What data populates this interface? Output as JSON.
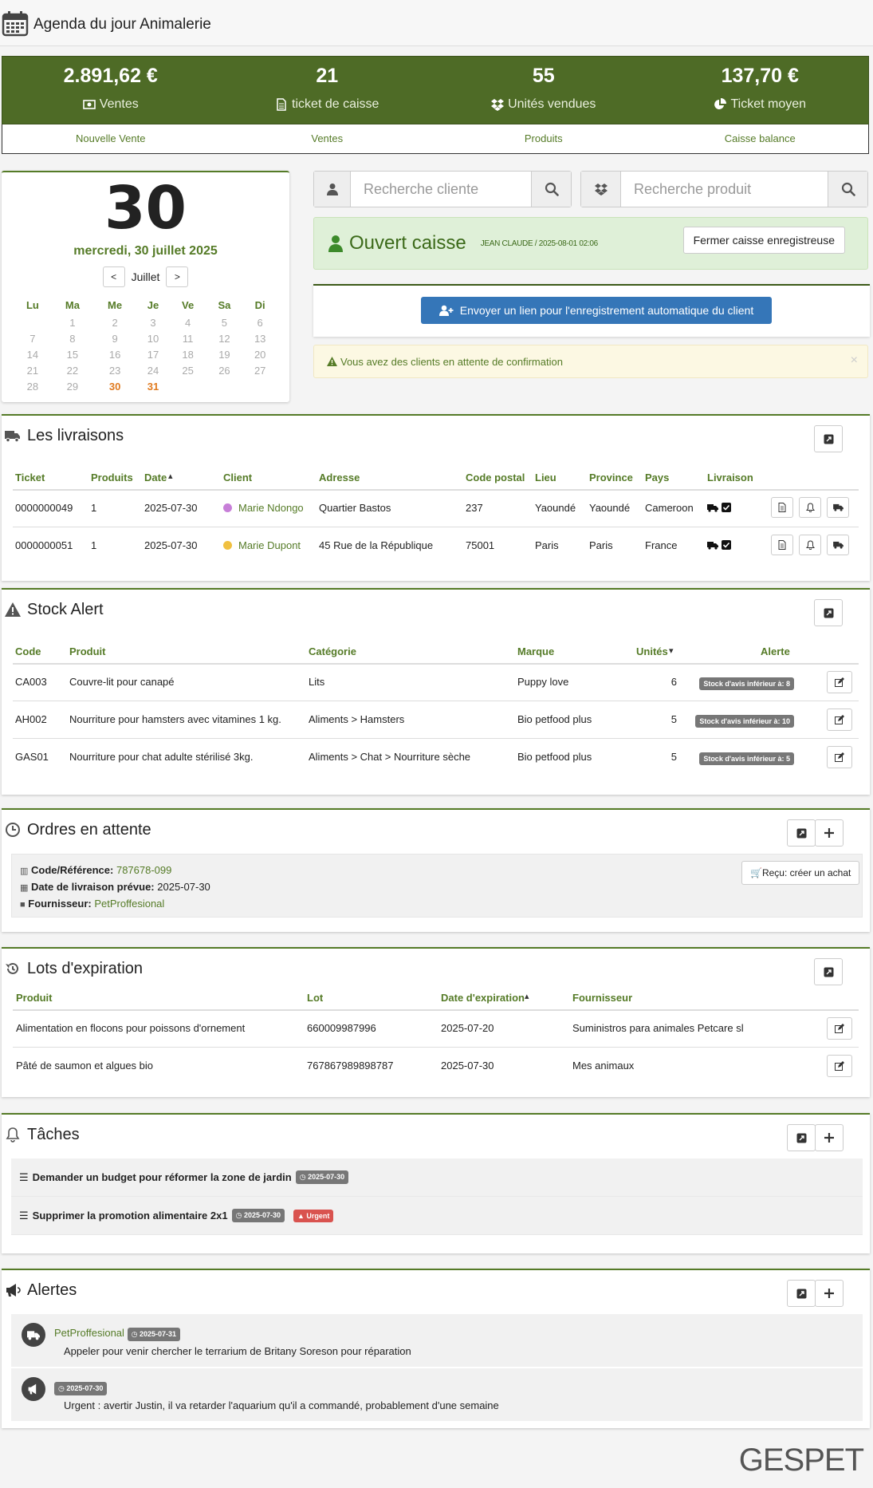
{
  "header": {
    "title": "Agenda du jour Animalerie"
  },
  "stats": [
    {
      "value": "2.891,62 €",
      "label": "Ventes",
      "icon": "money-icon"
    },
    {
      "value": "21",
      "label": "ticket de caisse",
      "icon": "file-icon"
    },
    {
      "value": "55",
      "label": "Unités vendues",
      "icon": "dropbox-icon"
    },
    {
      "value": "137,70 €",
      "label": "Ticket moyen",
      "icon": "pie-chart-icon"
    }
  ],
  "links": [
    "Nouvelle Vente",
    "Ventes",
    "Produits",
    "Caisse balance"
  ],
  "calendar": {
    "day": "30",
    "date": "mercredi, 30 juillet 2025",
    "prev": "<",
    "next": ">",
    "month": "Juillet",
    "weekdays": [
      "Lu",
      "Ma",
      "Me",
      "Je",
      "Ve",
      "Sa",
      "Di"
    ],
    "weeks": [
      [
        "",
        "1",
        "2",
        "3",
        "4",
        "5",
        "6"
      ],
      [
        "7",
        "8",
        "9",
        "10",
        "11",
        "12",
        "13"
      ],
      [
        "14",
        "15",
        "16",
        "17",
        "18",
        "19",
        "20"
      ],
      [
        "21",
        "22",
        "23",
        "24",
        "25",
        "26",
        "27"
      ],
      [
        "28",
        "29",
        "30",
        "31",
        "",
        "",
        ""
      ]
    ],
    "highlight": [
      "30",
      "31"
    ]
  },
  "search": {
    "client_placeholder": "Recherche cliente",
    "product_placeholder": "Recherche produit"
  },
  "register": {
    "status": "Ouvert caisse",
    "info": "JEAN CLAUDE / 2025-08-01 02:06",
    "close_button": "Fermer caisse enregistreuse"
  },
  "send_link": {
    "label": "Envoyer un lien pour l'enregistrement  automatique du client"
  },
  "warning": {
    "text": "Vous avez des clients en attente de confirmation",
    "close": "×"
  },
  "deliveries": {
    "title": "Les livraisons",
    "columns": [
      "Ticket",
      "Produits",
      "Date",
      "Client",
      "Adresse",
      "Code postal",
      "Lieu",
      "Province",
      "Pays",
      "Livraison"
    ],
    "rows": [
      {
        "ticket": "0000000049",
        "products": "1",
        "date": "2025-07-30",
        "client": "Marie Ndongo",
        "client_color": "#c77fd8",
        "address": "Quartier Bastos",
        "postal": "237",
        "city": "Yaoundé",
        "province": "Yaoundé",
        "country": "Cameroon"
      },
      {
        "ticket": "0000000051",
        "products": "1",
        "date": "2025-07-30",
        "client": "Marie Dupont",
        "client_color": "#f0c040",
        "address": "45 Rue de la République",
        "postal": "75001",
        "city": "Paris",
        "province": "Paris",
        "country": "France"
      }
    ]
  },
  "stock": {
    "title": "Stock Alert",
    "columns": [
      "Code",
      "Produit",
      "Catégorie",
      "Marque",
      "Unités",
      "Alerte"
    ],
    "rows": [
      {
        "code": "CA003",
        "product": "Couvre-lit pour canapé",
        "category": "Lits",
        "brand": "Puppy love",
        "units": "6",
        "alert": "Stock d'avis inférieur à: 8"
      },
      {
        "code": "AH002",
        "product": "Nourriture pour hamsters avec vitamines 1 kg.",
        "category": "Aliments > Hamsters",
        "brand": "Bio petfood plus",
        "units": "5",
        "alert": "Stock d'avis inférieur à: 10"
      },
      {
        "code": "GAS01",
        "product": "Nourriture pour chat adulte stérilisé 3kg.",
        "category": "Aliments > Chat > Nourriture sèche",
        "brand": "Bio petfood plus",
        "units": "5",
        "alert": "Stock d'avis inférieur à: 5"
      }
    ]
  },
  "orders": {
    "title": "Ordres en attente",
    "code_label": "Code/Référence:",
    "code": "787678-099",
    "date_label": "Date de livraison prévue:",
    "date": "2025-07-30",
    "supplier_label": "Fournisseur:",
    "supplier": "PetProffesional",
    "receive_button": "Reçu: créer un achat"
  },
  "lots": {
    "title": "Lots d'expiration",
    "columns": [
      "Produit",
      "Lot",
      "Date d'expiration",
      "Fournisseur"
    ],
    "rows": [
      {
        "product": "Alimentation en flocons pour poissons d'ornement",
        "lot": "660009987996",
        "date": "2025-07-20",
        "supplier": "Suministros para animales Petcare sl"
      },
      {
        "product": "Pâté de saumon et algues bio",
        "lot": "767867989898787",
        "date": "2025-07-30",
        "supplier": "Mes animaux"
      }
    ]
  },
  "tasks": {
    "title": "Tâches",
    "items": [
      {
        "text": "Demander un budget pour réformer la zone de jardin",
        "date": "2025-07-30",
        "urgent": ""
      },
      {
        "text": "Supprimer la promotion alimentaire 2x1",
        "date": "2025-07-30",
        "urgent": "Urgent"
      }
    ]
  },
  "alerts": {
    "title": "Alertes",
    "items": [
      {
        "author": "PetProffesional",
        "date": "2025-07-31",
        "text": "Appeler pour venir chercher le terrarium de Britany Soreson pour réparation",
        "icon": "truck-icon"
      },
      {
        "author": "",
        "date": "2025-07-30",
        "text": "Urgent : avertir Justin, il va retarder l'aquarium qu'il a commandé, probablement d'une semaine",
        "icon": "bullhorn-icon"
      }
    ]
  },
  "footer": {
    "logo": "GESPET"
  },
  "colors": {
    "brand": "#557b27",
    "stats_bg": "#4e6b26",
    "button_blue": "#3576b8",
    "danger": "#d9534f",
    "badge": "#777777"
  }
}
